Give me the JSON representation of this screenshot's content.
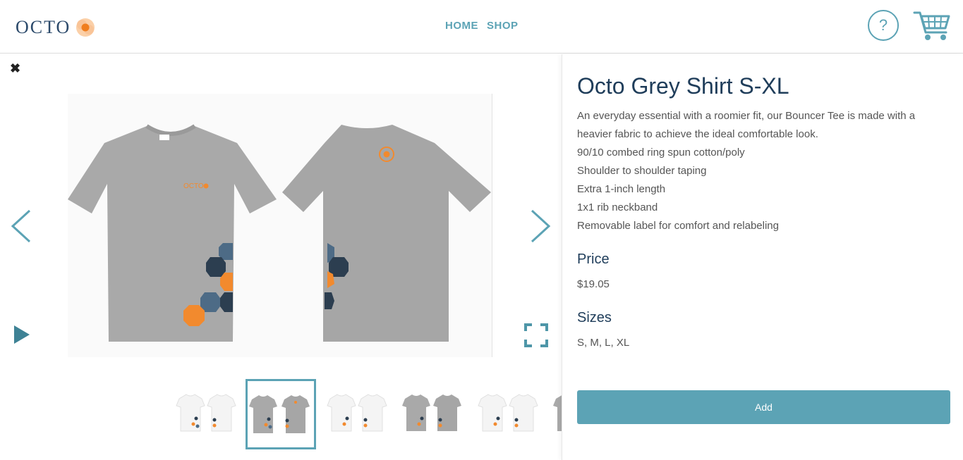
{
  "brand": {
    "logo_text": "OCTO",
    "accent": "#f28a2e",
    "primary": "#5ca3b5",
    "navy": "#1f3d5a"
  },
  "nav": {
    "items": [
      "HOME",
      "SHOP"
    ]
  },
  "header": {
    "help_label": "?",
    "help_icon": "question-circle-icon",
    "cart_icon": "cart-icon"
  },
  "gallery": {
    "close_icon": "close-icon",
    "prev_icon": "chevron-left-icon",
    "next_icon": "chevron-right-icon",
    "play_icon": "play-icon",
    "fullscreen_icon": "fullscreen-icon",
    "thumbnails": [
      {
        "shirt": "white",
        "active": false
      },
      {
        "shirt": "grey",
        "active": true
      },
      {
        "shirt": "white",
        "active": false
      },
      {
        "shirt": "grey",
        "active": false
      },
      {
        "shirt": "white",
        "active": false
      },
      {
        "shirt": "grey",
        "active": false
      }
    ]
  },
  "product": {
    "title": "Octo Grey Shirt S-XL",
    "description": [
      "An everyday essential with a roomier fit, our Bouncer Tee is made with a heavier fabric to achieve the ideal comfortable look.",
      "90/10 combed ring spun cotton/poly",
      "Shoulder to shoulder taping",
      "Extra 1-inch length",
      "1x1 rib neckband",
      "Removable label for comfort and relabeling"
    ],
    "price_label": "Price",
    "price": "$19.05",
    "sizes_label": "Sizes",
    "sizes": "S, M, L, XL",
    "add_label": "Add"
  }
}
